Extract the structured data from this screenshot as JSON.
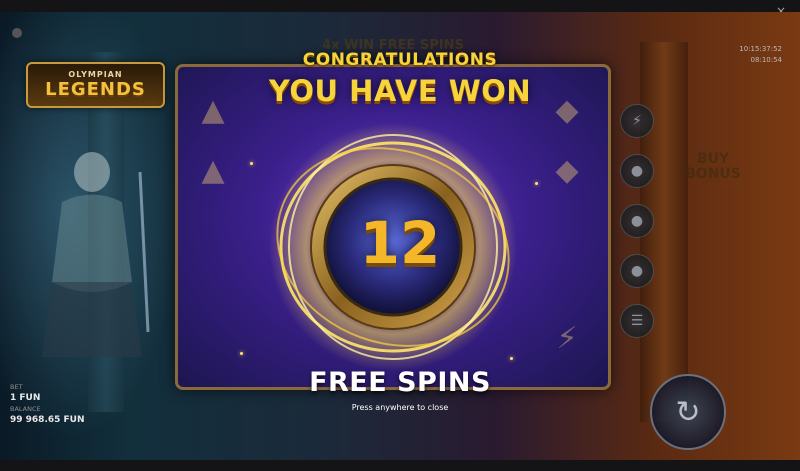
{
  "hud": {
    "top_right_line1": "10:15:37:52",
    "top_right_line2": "08:10:54"
  },
  "game": {
    "logo_top": "OLYMPIAN",
    "logo_main": "LEGENDS",
    "header_banner": "4x  WIN FREE SPINS",
    "buy_bonus": "BUY BONUS"
  },
  "popup": {
    "congratulations": "CONGRATULATIONS",
    "you_have_won": "YOU HAVE WON",
    "spins_count": "12",
    "free_spins": "FREE SPINS",
    "close_hint": "Press anywhere to close"
  },
  "bottom_left": {
    "bet_label": "BET",
    "bet_value": "1 FUN",
    "balance_label": "BALANCE",
    "balance_value": "99 968.65 FUN"
  },
  "icons": [
    "info-icon",
    "close-icon",
    "lightning-icon",
    "spin-icon",
    "gem-icon",
    "triangle-icon"
  ],
  "colors": {
    "gold": "#f7d43a",
    "board_purple": "#3a1f8a",
    "ring_glow": "#ffe04a"
  }
}
